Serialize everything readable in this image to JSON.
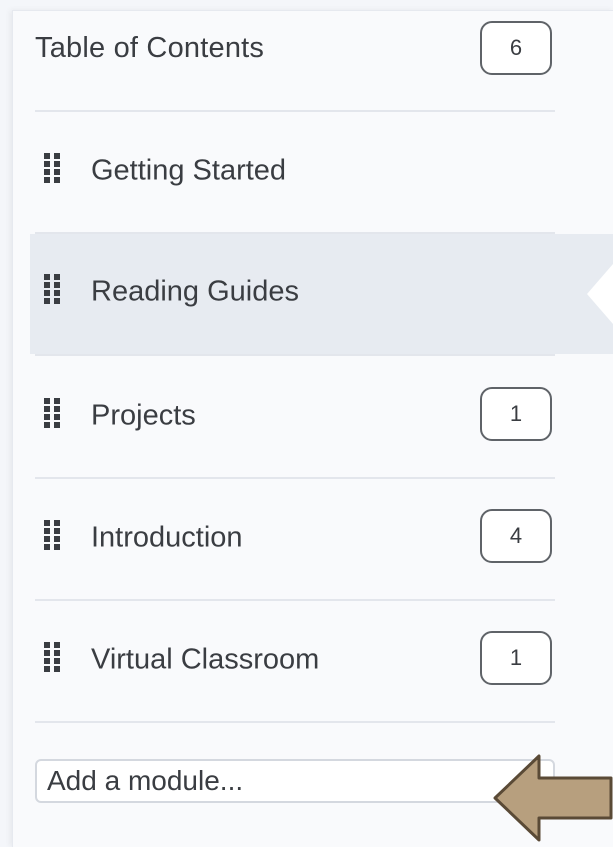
{
  "toc": {
    "title": "Table of Contents",
    "count": "6"
  },
  "modules": [
    {
      "label": "Getting Started",
      "count": ""
    },
    {
      "label": "Reading Guides",
      "count": "",
      "selected": true
    },
    {
      "label": "Projects",
      "count": "1"
    },
    {
      "label": "Introduction",
      "count": "4"
    },
    {
      "label": "Virtual Classroom",
      "count": "1"
    }
  ],
  "add_module": {
    "placeholder": "Add a module..."
  },
  "icons": {
    "drag": "drag-handle-icon",
    "pointer": "arrow-left-icon"
  },
  "colors": {
    "selected_row": "#e7ebf1",
    "arrow_fill": "#b79f7e",
    "arrow_stroke": "#5a4a36"
  }
}
